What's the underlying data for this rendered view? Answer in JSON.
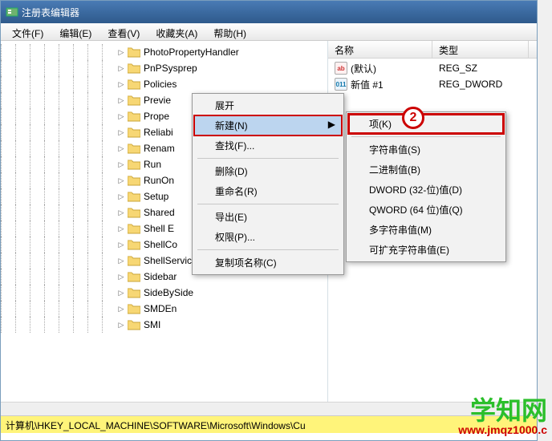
{
  "title": "注册表编辑器",
  "menubar": [
    "文件(F)",
    "编辑(E)",
    "查看(V)",
    "收藏夹(A)",
    "帮助(H)"
  ],
  "tree_items": [
    "PhotoPropertyHandler",
    "PnPSysprep",
    "Policies",
    "Previe",
    "Prope",
    "Reliabi",
    "Renam",
    "Run",
    "RunOn",
    "Setup",
    "Shared",
    "Shell E",
    "ShellCo",
    "ShellServiceObjectDelayLoad",
    "Sidebar",
    "SideBySide",
    "SMDEn",
    "SMI"
  ],
  "list": {
    "columns": {
      "name": "名称",
      "type": "类型"
    },
    "rows": [
      {
        "icon": "ab",
        "name": "(默认)",
        "type": "REG_SZ"
      },
      {
        "icon": "dw",
        "name": "新值 #1",
        "type": "REG_DWORD"
      }
    ],
    "col_widths": {
      "name": 130,
      "type": 120
    }
  },
  "context_menu1": {
    "header": "展开",
    "items": [
      {
        "label": "新建(N)",
        "has_submenu": true,
        "highlight": true
      },
      {
        "label": "查找(F)..."
      },
      {
        "sep": true
      },
      {
        "label": "删除(D)"
      },
      {
        "label": "重命名(R)"
      },
      {
        "sep": true
      },
      {
        "label": "导出(E)"
      },
      {
        "label": "权限(P)..."
      },
      {
        "sep": true
      },
      {
        "label": "复制项名称(C)"
      }
    ]
  },
  "context_menu2": {
    "items": [
      {
        "label": "项(K)",
        "hover": true
      },
      {
        "sep": true
      },
      {
        "label": "字符串值(S)"
      },
      {
        "label": "二进制值(B)"
      },
      {
        "label": "DWORD (32-位)值(D)"
      },
      {
        "label": "QWORD (64 位)值(Q)"
      },
      {
        "label": "多字符串值(M)"
      },
      {
        "label": "可扩充字符串值(E)"
      }
    ]
  },
  "step_badge": "2",
  "status_path": "计算机\\HKEY_LOCAL_MACHINE\\SOFTWARE\\Microsoft\\Windows\\Cu",
  "watermark": {
    "text": "学知网",
    "url": "www.jmqz1000.c"
  },
  "colors": {
    "titlebar_start": "#4a7bb5",
    "highlight": "#c00",
    "statusbar_bg": "#fff47a",
    "watermark_text": "#2bbf2b"
  }
}
